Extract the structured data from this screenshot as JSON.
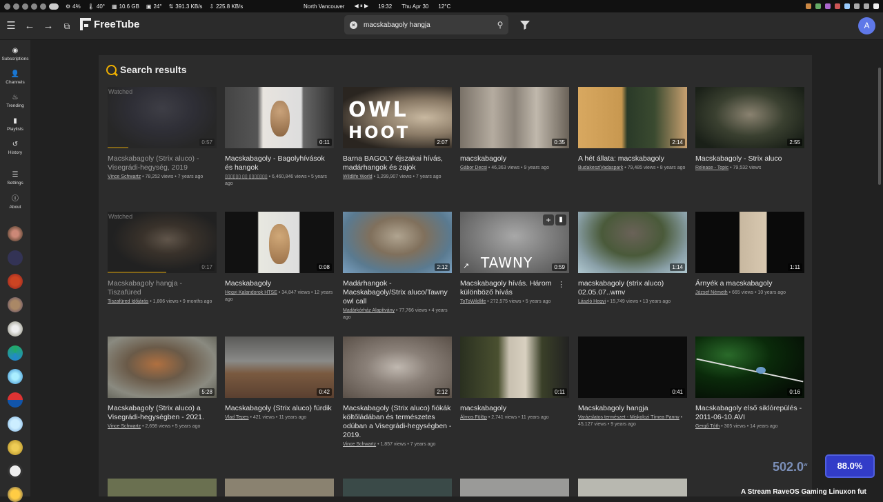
{
  "system_bar": {
    "cpu": "4%",
    "temp1": "40°",
    "ram": "10.6 GB",
    "temp2": "24°",
    "net_up": "391.3 KB/s",
    "net_down": "225.8 KB/s",
    "location": "North Vancouver",
    "time": "19:32",
    "date": "Thu Apr 30",
    "weather": "12°C"
  },
  "app": {
    "name": "FreeTube",
    "search_value": "macskabagoly hangja",
    "avatar_letter": "A",
    "section_title": "Search results"
  },
  "sidebar": {
    "items": [
      {
        "label": "Subscriptions",
        "icon": "rss-icon"
      },
      {
        "label": "Channels",
        "icon": "users-icon"
      },
      {
        "label": "Trending",
        "icon": "fire-icon"
      },
      {
        "label": "Playlists",
        "icon": "bookmark-icon"
      },
      {
        "label": "History",
        "icon": "history-icon"
      },
      {
        "label": "Settings",
        "icon": "sliders-icon"
      },
      {
        "label": "About",
        "icon": "info-icon"
      }
    ]
  },
  "videos": [
    {
      "title": "Macskabagoly (Strix aluco) - Visegrádi-hegység, 2019",
      "channel": "Vince Schwartz",
      "meta": " • 78,252 views • 7 years ago",
      "duration": "0:57",
      "watched": "Watched"
    },
    {
      "title": "Macskabagoly - Bagolyhívások és hangok",
      "channel": "▯▯▯▯▯▯ ▯▯ ▯▯▯▯▯▯▯",
      "meta": " • 6,460,846 views • 5 years ago",
      "duration": "0:11"
    },
    {
      "title": "Barna BAGOLY éjszakai hívás, madárhangok és zajok",
      "channel": "Wildlife World",
      "meta": " • 1,299,907 views • 7 years ago",
      "duration": "2:07",
      "overlay1": "OWL",
      "overlay2": "HOOT"
    },
    {
      "title": "macskabagoly",
      "channel": "Gábor Decsi",
      "meta": " • 46,363 views • 9 years ago",
      "duration": "0:35"
    },
    {
      "title": "A hét állata: macskabagoly",
      "channel": "BudakesziVadaspark",
      "meta": " • 79,485 views • 8 years ago",
      "duration": "2:14"
    },
    {
      "title": "Macskabagoly - Strix aluco",
      "channel": "Release - Topic",
      "meta": " • 79,532 views",
      "duration": "2:55"
    },
    {
      "title": "Macskabagoly hangja - Tiszafüred",
      "channel": "Tiszafüred Időjárás",
      "meta": " • 1,806 views • 9 months ago",
      "duration": "0:17",
      "watched": "Watched"
    },
    {
      "title": "Macskabagoly",
      "channel": "Hegyi Kalandorok HTSE",
      "meta": " • 34,847 views • 12 years ago",
      "duration": "0:08"
    },
    {
      "title": "Madárhangok - Macskabagoly/Strix aluco/Tawny owl call",
      "channel": "Madárkórház Alapítvány",
      "meta": " • 77,766 views • 4 years ago",
      "duration": "2:12"
    },
    {
      "title": "Macskabagoly hívás. Három különböző hívás",
      "channel": "ToToWildlife",
      "meta": " • 272,575 views • 5 years ago",
      "duration": "0:59",
      "overlay1": "TAWNY OWL"
    },
    {
      "title": "macskabagoly (strix aluco) 02.05.07..wmv",
      "channel": "László Hegyi",
      "meta": " • 15,749 views • 13 years ago",
      "duration": "1:14"
    },
    {
      "title": "Árnyék a macskabagoly",
      "channel": "József Németh",
      "meta": " • 665 views • 10 years ago",
      "duration": "1:11"
    },
    {
      "title": "Macskabagoly (Strix aluco) a Visegrádi-hegységben - 2021.",
      "channel": "Vince Schwartz",
      "meta": " • 2,698 views • 5 years ago",
      "duration": "5:28"
    },
    {
      "title": "Macskabagoly (Strix aluco) fürdik",
      "channel": "Vlad Tepes",
      "meta": " • 421 views • 11 years ago",
      "duration": "0:42"
    },
    {
      "title": "Macskabagoly (Strix aluco) fiókák költőládában és természetes odúban a Visegrádi-hegységben - 2019.",
      "channel": "Vince Schwartz",
      "meta": " • 1,857 views • 7 years ago",
      "duration": "2:12"
    },
    {
      "title": "macskabagoly",
      "channel": "Álmos Fülöp",
      "meta": " • 2,741 views • 11 years ago",
      "duration": "0:11"
    },
    {
      "title": "Macskabagoly hangja",
      "channel": "Varázslatos természet - Miskolczi Tímea Panny",
      "meta": " • 45,127 views • 9 years ago",
      "duration": "0:41"
    },
    {
      "title": "Macskabagoly első siklórepülés - 2011-06-10.AVI",
      "channel": "Gergő Tóth",
      "meta": " • 305 views • 14 years ago",
      "duration": "0:16"
    }
  ],
  "overlay": {
    "power": "502.0",
    "power_unit": "w",
    "percent": "88.0%",
    "stream_text": "A Stream RaveOS Gaming Linuxon fut"
  }
}
